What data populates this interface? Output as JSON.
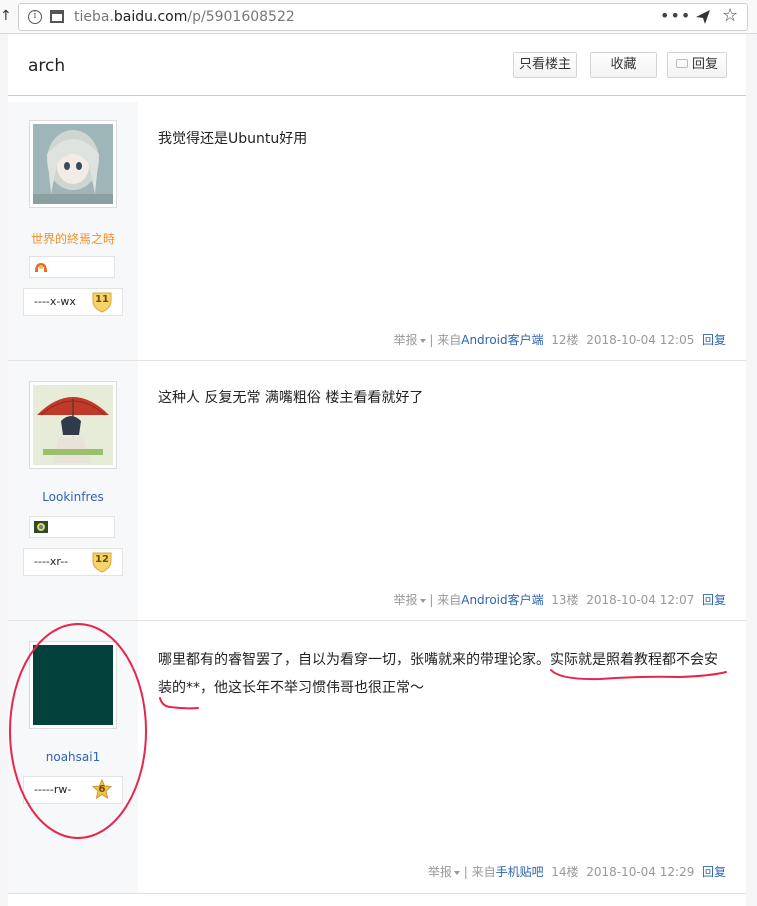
{
  "browser": {
    "url_host_prefix": "tieba.",
    "url_host_main": "baidu.com",
    "url_path": "/p/5901608522",
    "menu_dots": "•••"
  },
  "thread": {
    "title": "arch",
    "buttons": {
      "only_op": "只看楼主",
      "favorite": "收藏",
      "reply": "回复"
    }
  },
  "posts": [
    {
      "username": "世界的終焉之時",
      "username_color": "#f0902a",
      "level_name": "----x-wx",
      "level": "11",
      "content": "我觉得还是Ubuntu好用",
      "report": "举报",
      "source_prefix": "来自",
      "source": "Android客户端",
      "floor": "12楼",
      "time": "2018-10-04 12:05",
      "reply": "回复"
    },
    {
      "username": "Lookinfres",
      "username_color": "#2d64b3",
      "level_name": "----xr--",
      "level": "12",
      "content": "这种人 反复无常 满嘴粗俗 楼主看看就好了",
      "report": "举报",
      "source_prefix": "来自",
      "source": "Android客户端",
      "floor": "13楼",
      "time": "2018-10-04 12:07",
      "reply": "回复"
    },
    {
      "username": "noahsai1",
      "username_color": "#2d64b3",
      "level_name": "-----rw-",
      "level": "6",
      "content_line1": "哪里都有的睿智罢了，自以为看穿一切，张嘴就来的带理论家。实际就是照着教程都不会安",
      "content_line2": "装的**，他这长年不举习惯伟哥也很正常～",
      "report": "举报",
      "source_prefix": "来自",
      "source": "手机贴吧",
      "floor": "14楼",
      "time": "2018-10-04 12:29",
      "reply": "回复"
    }
  ],
  "colors": {
    "link": "#2d64b3",
    "annotation": "#e8264d",
    "avatar3": "#03413c"
  }
}
